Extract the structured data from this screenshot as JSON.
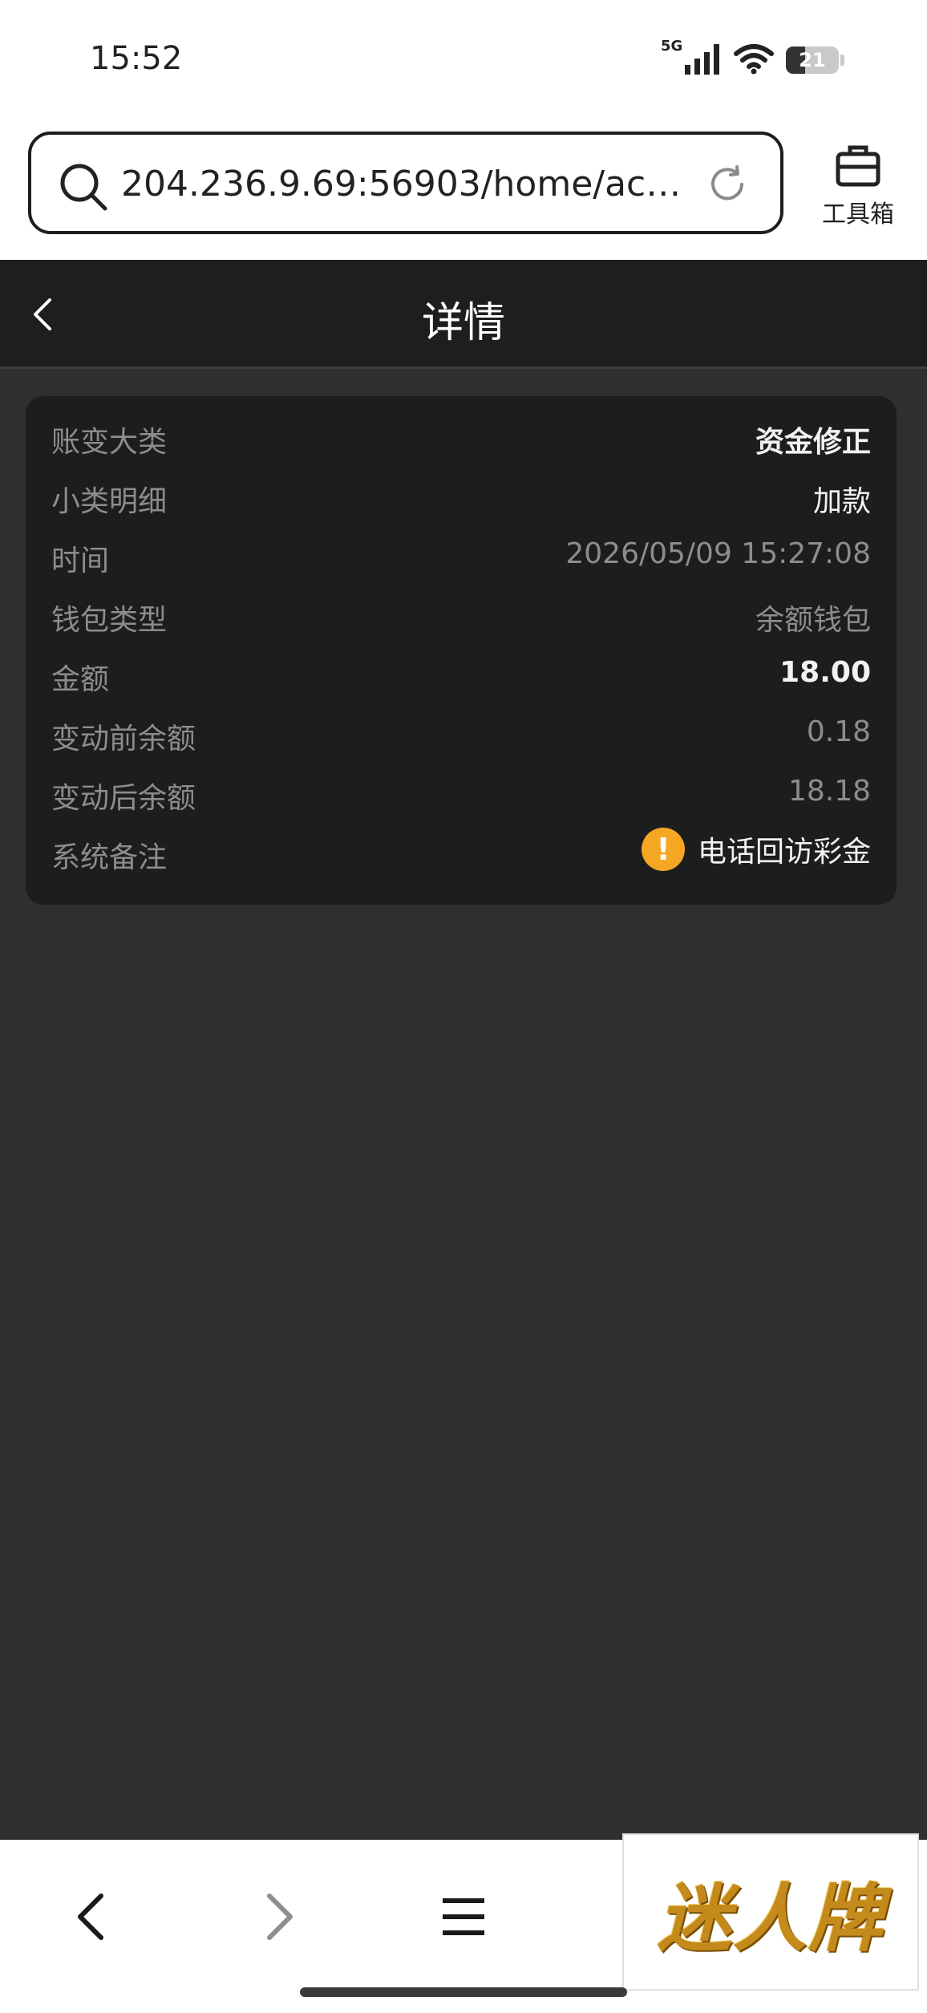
{
  "status_bar": {
    "time": "15:52",
    "network": "5G",
    "battery": "21"
  },
  "browser": {
    "url": "204.236.9.69:56903/home/accou...",
    "toolbox_label": "工具箱"
  },
  "header": {
    "title": "详情"
  },
  "details": [
    {
      "label": "账变大类",
      "value": "资金修正"
    },
    {
      "label": "小类明细",
      "value": "加款"
    },
    {
      "label": "时间",
      "value": "2026/05/09 15:27:08"
    },
    {
      "label": "钱包类型",
      "value": "余额钱包"
    },
    {
      "label": "金额",
      "value": "18.00"
    },
    {
      "label": "变动前余额",
      "value": "0.18"
    },
    {
      "label": "变动后余额",
      "value": "18.18"
    },
    {
      "label": "系统备注",
      "value": "电话回访彩金"
    }
  ],
  "brand_ad": {
    "text": "迷人牌"
  },
  "colors": {
    "header_bg": "#1e1e1e",
    "page_bg": "#2f2f2f",
    "card_bg": "#1d1d1d",
    "warning": "#f5a623"
  }
}
